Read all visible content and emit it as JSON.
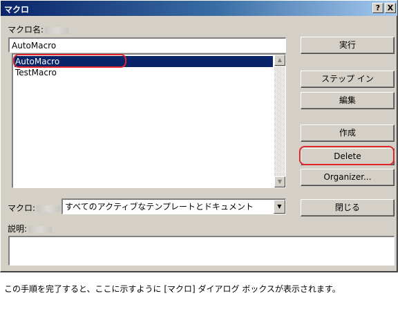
{
  "window": {
    "title": "マクロ",
    "help_button": "?",
    "close_button": "X"
  },
  "macro_name": {
    "label": "マクロ名:",
    "value": "AutoMacro"
  },
  "macro_list": {
    "items": [
      {
        "label": "AutoMacro",
        "selected": true
      },
      {
        "label": "TestMacro",
        "selected": false
      }
    ]
  },
  "buttons": {
    "run": "実行",
    "step_in": "ステップ イン",
    "edit": "編集",
    "create": "作成",
    "delete": "Delete",
    "organizer": "Organizer...",
    "close": "閉じる"
  },
  "macros_in": {
    "label": "マクロ:",
    "selected": "すべてのアクティブなテンプレートとドキュメント"
  },
  "description": {
    "label": "説明:",
    "value": ""
  },
  "caption": "この手順を完了すると、ここに示すように [マクロ] ダイアログ ボックスが表示されます。",
  "colors": {
    "highlight": "#e0262b",
    "selection": "#0a246a",
    "dialog_face": "#d4d0c8"
  }
}
